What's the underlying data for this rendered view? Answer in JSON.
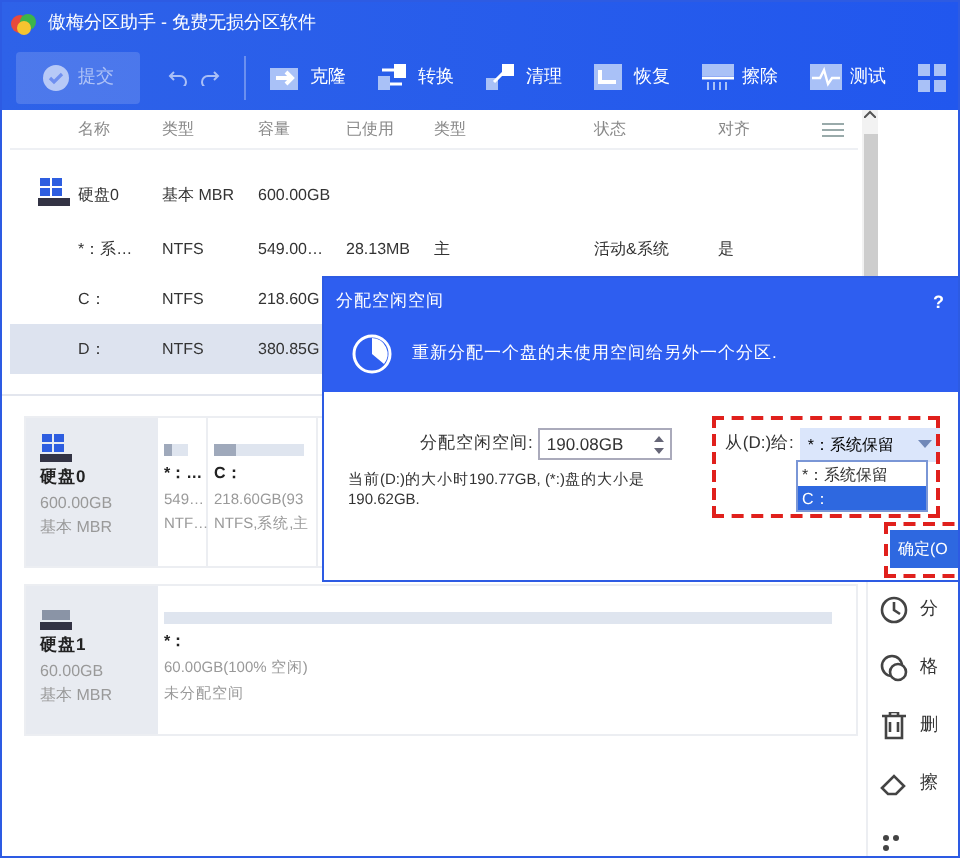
{
  "window": {
    "title": "傲梅分区助手 - 免费无损分区软件"
  },
  "toolbar": {
    "commit": {
      "label": "提交",
      "disabled": true
    },
    "items": [
      {
        "kind": "clone",
        "label": "克隆"
      },
      {
        "kind": "convert",
        "label": "转换"
      },
      {
        "kind": "clean",
        "label": "清理"
      },
      {
        "kind": "recover",
        "label": "恢复"
      },
      {
        "kind": "wipe",
        "label": "擦除"
      },
      {
        "kind": "test",
        "label": "测试"
      },
      {
        "kind": "apps"
      }
    ]
  },
  "table": {
    "columns": [
      "名称",
      "类型",
      "容量",
      "已使用",
      "类型",
      "状态",
      "对齐"
    ],
    "rows": [
      {
        "kind": "disk",
        "selected": false,
        "cells": [
          "硬盘0",
          "基本 MBR",
          "600.00GB"
        ]
      },
      {
        "kind": "partition",
        "selected": false,
        "cells": [
          "*：系…",
          "NTFS",
          "549.00…",
          "28.13MB",
          "主",
          "活动&系统",
          "是"
        ]
      },
      {
        "kind": "partition",
        "selected": false,
        "cells": [
          "C：",
          "NTFS",
          "218.60G"
        ]
      },
      {
        "kind": "partition",
        "selected": true,
        "cells": [
          "D：",
          "NTFS",
          "380.85G"
        ]
      }
    ]
  },
  "disks": [
    {
      "name": "硬盘0",
      "size": "600.00GB",
      "type": "基本 MBR",
      "partitions": [
        {
          "name": "*：…",
          "size": "549…",
          "info": "NTF…",
          "level": 0.35
        },
        {
          "name": "C：",
          "size": "218.60GB(93",
          "info": "NTFS,系统,主",
          "level": 0.25
        }
      ]
    },
    {
      "name": "硬盘1",
      "size": "60.00GB",
      "type": "基本 MBR",
      "partitions": [
        {
          "name": "*：",
          "size": "60.00GB(100% 空闲)",
          "info": "未分配空间"
        }
      ]
    }
  ],
  "actions": [
    {
      "kind": "clock",
      "label": "分"
    },
    {
      "kind": "format",
      "label": "格"
    },
    {
      "kind": "trash",
      "label": "删"
    },
    {
      "kind": "eraser",
      "label": "擦"
    },
    {
      "kind": "dots"
    }
  ],
  "dialog": {
    "title": "分配空闲空间",
    "help": "?",
    "description": "重新分配一个盘的未使用空间给另外一个分区.",
    "size_label": "分配空闲空间:",
    "size_value": "190.08GB",
    "from_label": "从(D:)给:",
    "dropdown": {
      "value": "*：系统保留",
      "options": [
        {
          "label": "*：系统保留",
          "highlighted": false
        },
        {
          "label": "C：",
          "highlighted": true
        }
      ]
    },
    "info": "当前(D:)的大小时190.77GB, (*:)盘的大小是190.62GB.",
    "ok": "确定(O"
  }
}
